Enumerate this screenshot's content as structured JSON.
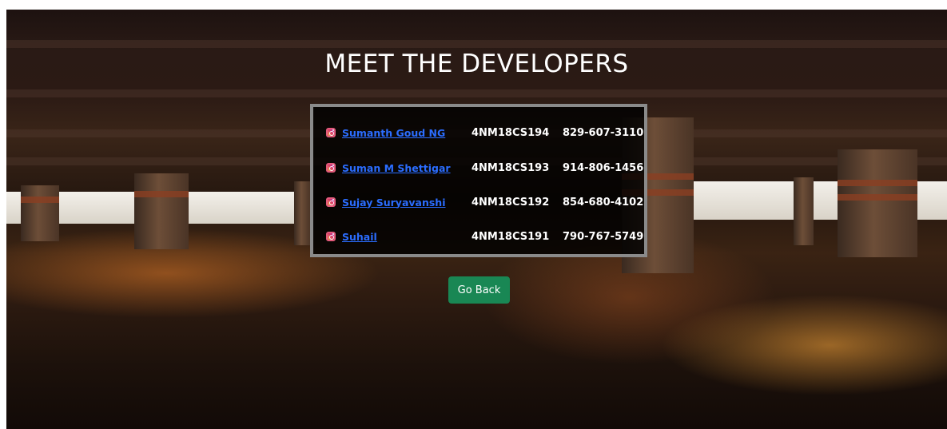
{
  "page": {
    "heading": "MEET THE DEVELOPERS",
    "back_button_label": "Go Back"
  },
  "developers": [
    {
      "name": "Sumanth Goud NG",
      "usn": "4NM18CS194",
      "phone": "829-607-3110"
    },
    {
      "name": "Suman M Shettigar",
      "usn": "4NM18CS193",
      "phone": "914-806-1456"
    },
    {
      "name": "Sujay Suryavanshi",
      "usn": "4NM18CS192",
      "phone": "854-680-4102"
    },
    {
      "name": "Suhail",
      "usn": "4NM18CS191",
      "phone": "790-767-5749"
    }
  ],
  "icons": {
    "developer_link_icon": "instagram-icon"
  },
  "colors": {
    "link": "#2b6dff",
    "button": "#198754",
    "panel_border": "#8a8a8a"
  }
}
